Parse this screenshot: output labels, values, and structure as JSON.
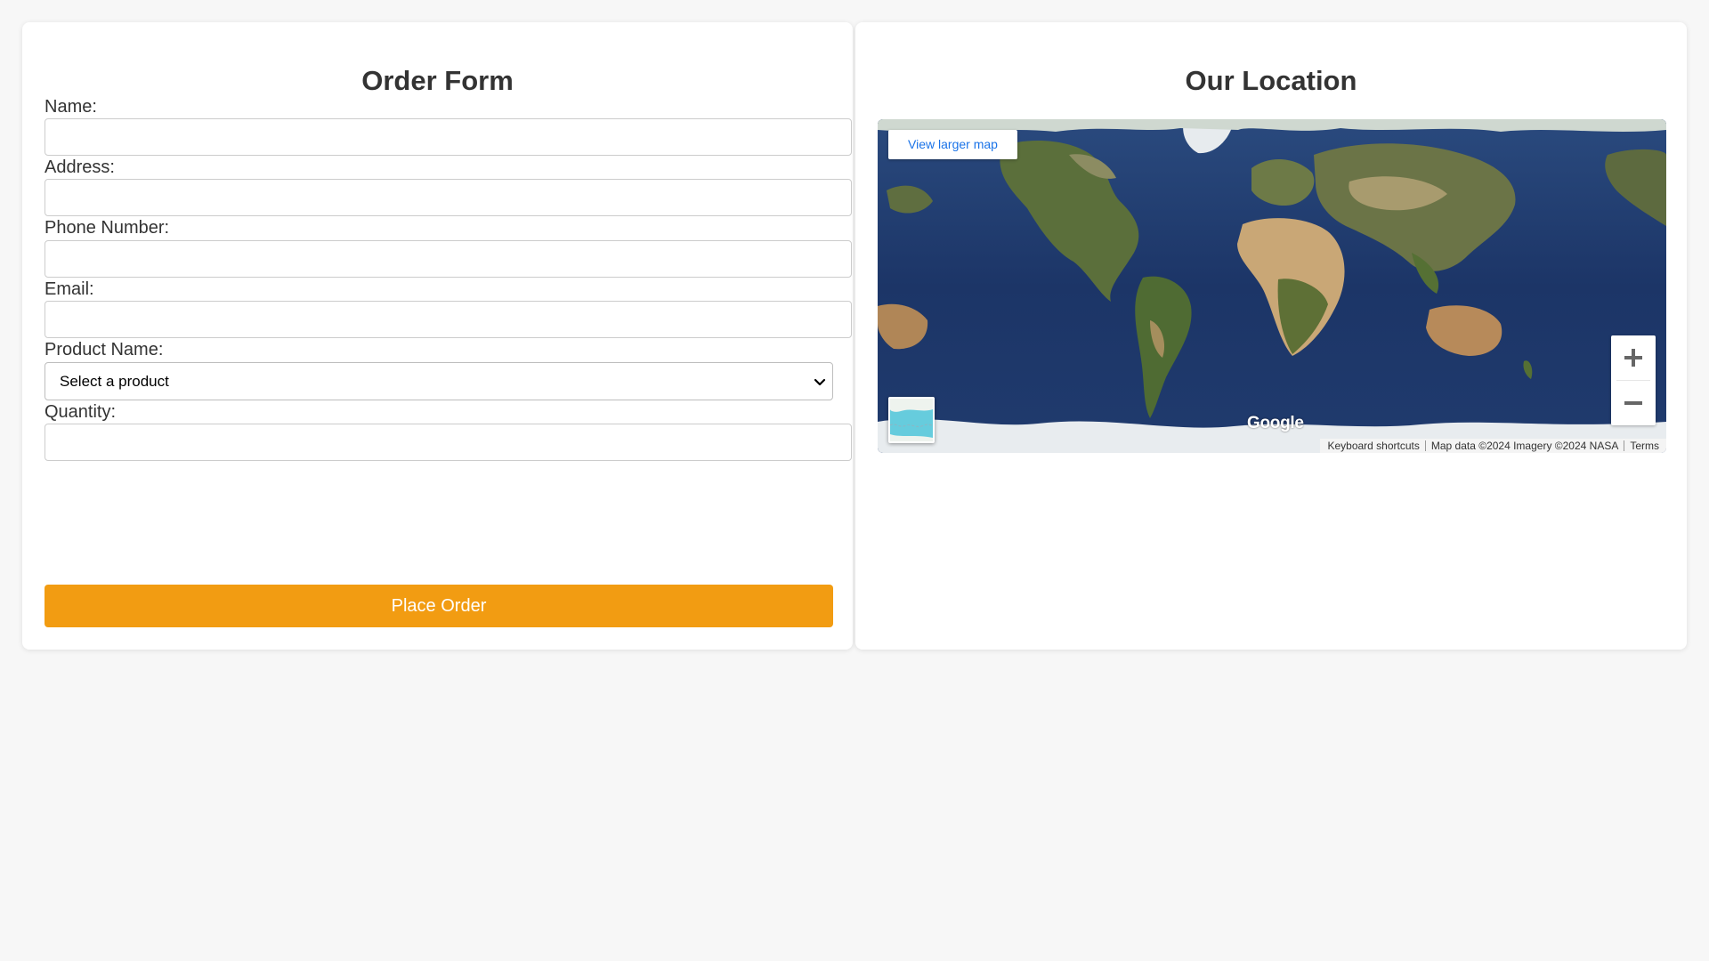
{
  "order_form": {
    "title": "Order Form",
    "fields": {
      "name": {
        "label": "Name:",
        "value": ""
      },
      "address": {
        "label": "Address:",
        "value": ""
      },
      "phone": {
        "label": "Phone Number:",
        "value": ""
      },
      "email": {
        "label": "Email:",
        "value": ""
      },
      "product": {
        "label": "Product Name:",
        "selected": "Select a product"
      },
      "quantity": {
        "label": "Quantity:",
        "value": ""
      }
    },
    "submit_label": "Place Order",
    "accent_color": "#f29c12"
  },
  "location": {
    "title": "Our Location",
    "map": {
      "larger_map_link": "View larger map",
      "zoom_in_icon": "plus-icon",
      "zoom_out_icon": "minus-icon",
      "logo": "Google",
      "attribution": {
        "shortcuts": "Keyboard shortcuts",
        "data": "Map data ©2024 Imagery ©2024 NASA",
        "terms": "Terms"
      }
    }
  }
}
